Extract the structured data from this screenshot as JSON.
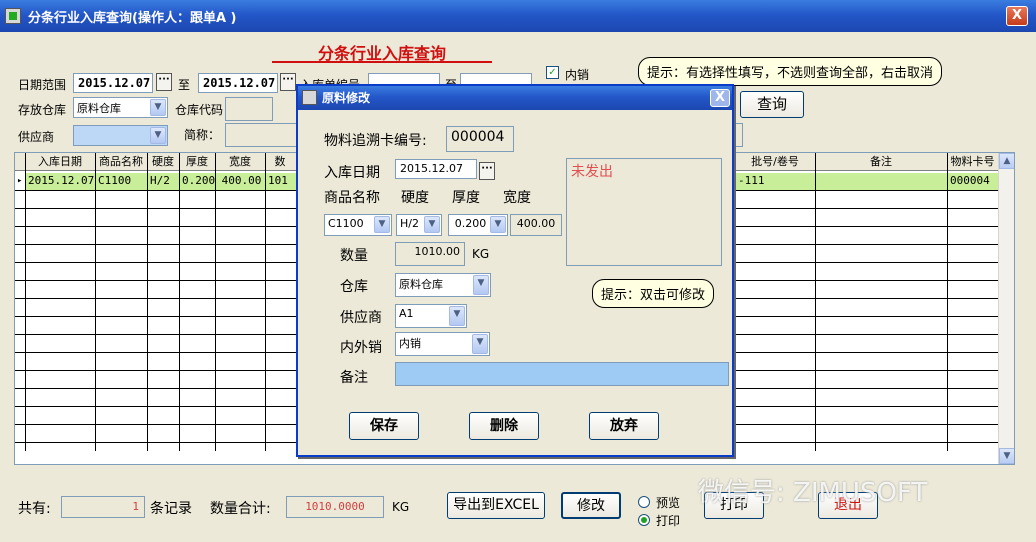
{
  "window": {
    "title": "分条行业入库查询(操作人：跟单A          )",
    "close_label": "X"
  },
  "report_title": "分条行业入库查询",
  "filters": {
    "date_range_label": "日期范围",
    "date_from": "2015.12.07",
    "to_label": "至",
    "date_to": "2015.12.07",
    "dots_label": "···",
    "partial_label": "入库单编号",
    "to2_label": "至",
    "domestic_label": "内销",
    "domestic_checked": "✓",
    "warehouse_label": "存放仓库",
    "warehouse_value": "原料仓库",
    "warehouse_code_label": "仓库代码",
    "supplier_label": "供应商",
    "abbr_label": "简称："
  },
  "tip_main": "提示：有选择性填写，不选则查询全部，右击取消",
  "query_button": "查询",
  "grid": {
    "columns": [
      "入库日期",
      "商品名称",
      "硬度",
      "厚度",
      "宽度",
      "数",
      "批号/卷号",
      "备注",
      "物料卡号"
    ],
    "row": [
      "2015.12.07",
      "C1100",
      "H/2",
      "0.200",
      "400.00",
      "101",
      "-111",
      "",
      "000004"
    ],
    "row_marker": "▸"
  },
  "dialog": {
    "title": "原料修改",
    "close_label": "X",
    "trace_card_label": "物料追溯卡编号:",
    "trace_card_value": "000004",
    "in_date_label": "入库日期",
    "in_date_value": "2015.12.07",
    "dots_label": "···",
    "not_shipped": "未发出",
    "product_label": "商品名称",
    "hardness_label": "硬度",
    "thickness_label": "厚度",
    "width_label": "宽度",
    "product_value": "C1100",
    "hardness_value": "H/2",
    "thickness_value": "0.200",
    "width_value": "400.00",
    "quantity_label": "数量",
    "quantity_value": "1010.00",
    "quantity_unit": "KG",
    "tip": "提示：双击可修改",
    "warehouse_label": "仓库",
    "warehouse_value": "原料仓库",
    "supplier_label": "供应商",
    "supplier_value": "A1",
    "sales_type_label": "内外销",
    "sales_type_value": "内销",
    "remark_label": "备注",
    "save_button": "保存",
    "delete_button": "删除",
    "discard_button": "放弃"
  },
  "footer": {
    "total_label": "共有:",
    "total_value": "1",
    "records_label": "条记录",
    "qty_sum_label": "数量合计:",
    "qty_sum_value": "1010.0000",
    "qty_unit": "KG",
    "export_button": "导出到EXCEL",
    "modify_button": "修改",
    "preview_label": "预览",
    "print_label": "打印",
    "print_button": "打印",
    "exit_button": "退出"
  },
  "watermark": "微信号: ZIMUSOFT",
  "colors": {
    "accent": "#2457c9",
    "title_red": "#d01010",
    "selected_row": "#c8ee9a",
    "tip_bg": "#ffffe1"
  }
}
